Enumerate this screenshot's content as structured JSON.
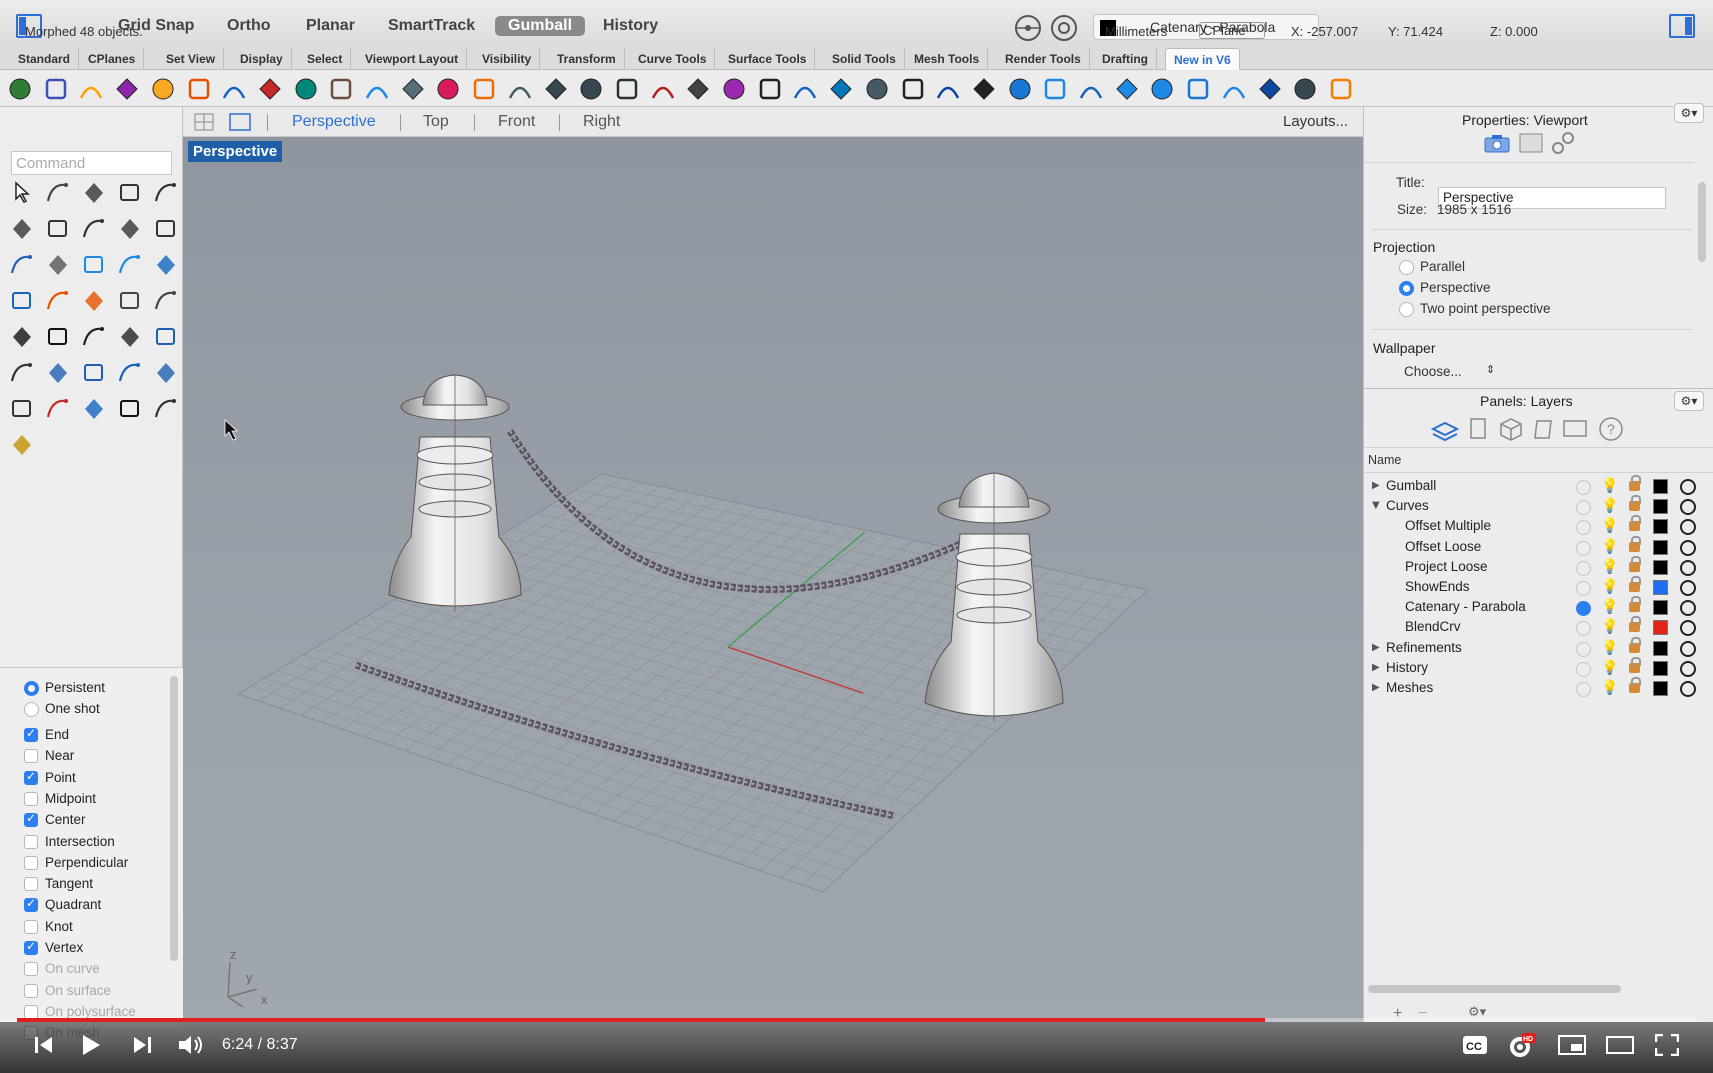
{
  "top_bar": {
    "modes": [
      "Grid Snap",
      "Ortho",
      "Planar",
      "SmartTrack",
      "Gumball",
      "History"
    ],
    "active_mode": "Gumball",
    "current_layer": "Catenary - Parabola"
  },
  "toolbar_tabs": [
    "Standard",
    "CPlanes",
    "Set View",
    "Display",
    "Select",
    "Viewport Layout",
    "Visibility",
    "Transform",
    "Curve Tools",
    "Surface Tools",
    "Solid Tools",
    "Mesh Tools",
    "Render Tools",
    "Drafting",
    "New in V6"
  ],
  "active_toolbar_tab": "New in V6",
  "command": {
    "placeholder": "Command"
  },
  "viewport_tabs": [
    "Perspective",
    "Top",
    "Front",
    "Right"
  ],
  "active_viewport_tab": "Perspective",
  "layouts_label": "Layouts...",
  "viewport_label": "Perspective",
  "osnap": {
    "modes": [
      {
        "label": "Persistent",
        "type": "radio",
        "checked": true
      },
      {
        "label": "One shot",
        "type": "radio",
        "checked": false
      }
    ],
    "items": [
      {
        "label": "End",
        "checked": true
      },
      {
        "label": "Near",
        "checked": false
      },
      {
        "label": "Point",
        "checked": true
      },
      {
        "label": "Midpoint",
        "checked": false
      },
      {
        "label": "Center",
        "checked": true
      },
      {
        "label": "Intersection",
        "checked": false
      },
      {
        "label": "Perpendicular",
        "checked": false
      },
      {
        "label": "Tangent",
        "checked": false
      },
      {
        "label": "Quadrant",
        "checked": true
      },
      {
        "label": "Knot",
        "checked": false
      },
      {
        "label": "Vertex",
        "checked": true
      },
      {
        "label": "On curve",
        "checked": false,
        "disabled": true
      },
      {
        "label": "On surface",
        "checked": false,
        "disabled": true
      },
      {
        "label": "On polysurface",
        "checked": false,
        "disabled": true
      },
      {
        "label": "On mesh",
        "checked": false,
        "disabled": true
      }
    ]
  },
  "properties": {
    "header": "Properties: Viewport",
    "title_label": "Title:",
    "title_value": "Perspective",
    "size_label": "Size:",
    "size_value": "1985 x 1516",
    "projection_label": "Projection",
    "projection_options": [
      {
        "label": "Parallel",
        "selected": false
      },
      {
        "label": "Perspective",
        "selected": true
      },
      {
        "label": "Two point perspective",
        "selected": false
      }
    ],
    "wallpaper_label": "Wallpaper",
    "wallpaper_choose": "Choose..."
  },
  "layers_panel": {
    "header": "Panels: Layers",
    "name_col": "Name",
    "rows": [
      {
        "name": "Gumball",
        "indent": 0,
        "expand": "▶",
        "bulb_lit": false,
        "color": "#000000",
        "current": false
      },
      {
        "name": "Curves",
        "indent": 0,
        "expand": "▼",
        "bulb_lit": true,
        "color": "#000000",
        "current": false
      },
      {
        "name": "Offset Multiple",
        "indent": 1,
        "expand": "",
        "bulb_lit": false,
        "color": "#000000",
        "current": false
      },
      {
        "name": "Offset Loose",
        "indent": 1,
        "expand": "",
        "bulb_lit": false,
        "color": "#000000",
        "current": false
      },
      {
        "name": "Project Loose",
        "indent": 1,
        "expand": "",
        "bulb_lit": false,
        "color": "#000000",
        "current": false
      },
      {
        "name": "ShowEnds",
        "indent": 1,
        "expand": "",
        "bulb_lit": false,
        "color": "#1e6ef0",
        "current": false
      },
      {
        "name": "Catenary - Parabola",
        "indent": 1,
        "expand": "",
        "bulb_lit": true,
        "color": "#000000",
        "current": true
      },
      {
        "name": "BlendCrv",
        "indent": 1,
        "expand": "",
        "bulb_lit": false,
        "color": "#e0261a",
        "current": false
      },
      {
        "name": "Refinements",
        "indent": 0,
        "expand": "▶",
        "bulb_lit": false,
        "color": "#000000",
        "current": false
      },
      {
        "name": "History",
        "indent": 0,
        "expand": "▶",
        "bulb_lit": false,
        "color": "#000000",
        "current": false
      },
      {
        "name": "Meshes",
        "indent": 0,
        "expand": "▶",
        "bulb_lit": false,
        "color": "#000000",
        "current": false
      }
    ]
  },
  "status_bar": {
    "message": "Morphed 48 objects.",
    "units": "Millimeters",
    "cplane": "CPlane",
    "x": "X: -257.007",
    "y": "Y: 71.424",
    "z": "Z: 0.000"
  },
  "video_player": {
    "time": "6:24 / 8:37",
    "progress_fraction": 0.743
  },
  "axis_labels": {
    "z": "z",
    "y": "y",
    "x": "x"
  },
  "colors": {
    "accent": "#2d6fd6",
    "progress": "#e02020",
    "viewport_label_bg": "#1f5fa8"
  }
}
